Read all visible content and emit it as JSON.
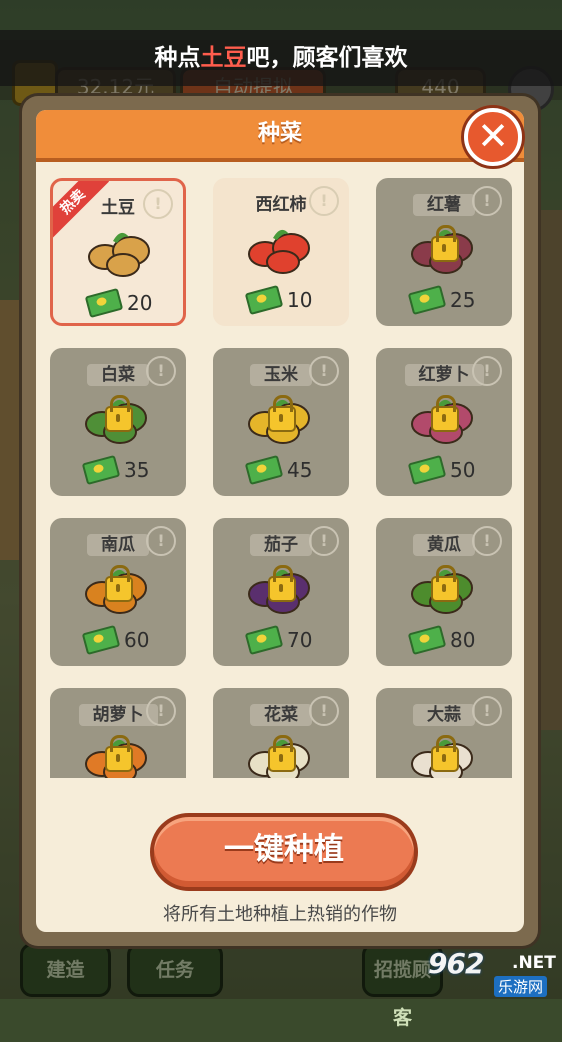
{
  "top_hint": {
    "before": "种点",
    "highlight": "土豆",
    "after": "吧，顾客们喜欢"
  },
  "hud": {
    "cash": "32.12元",
    "auto": "自动提拟",
    "count": "440"
  },
  "dialog": {
    "title": "种菜",
    "close_label": "✕",
    "ribbon": "热卖",
    "crops": [
      {
        "name": "土豆",
        "price": "20",
        "state": "selected",
        "color": "#d9a24a"
      },
      {
        "name": "西红柿",
        "price": "10",
        "state": "unlocked",
        "color": "#e0412e"
      },
      {
        "name": "红薯",
        "price": "25",
        "state": "locked",
        "color": "#8a3b4a"
      },
      {
        "name": "白菜",
        "price": "35",
        "state": "locked",
        "color": "#4f8f37"
      },
      {
        "name": "玉米",
        "price": "45",
        "state": "locked",
        "color": "#e5b52a"
      },
      {
        "name": "红萝卜",
        "price": "50",
        "state": "locked",
        "color": "#b24a6b"
      },
      {
        "name": "南瓜",
        "price": "60",
        "state": "locked",
        "color": "#d9821f"
      },
      {
        "name": "茄子",
        "price": "70",
        "state": "locked",
        "color": "#5a2f6e"
      },
      {
        "name": "黄瓜",
        "price": "80",
        "state": "locked",
        "color": "#4d8c2d"
      },
      {
        "name": "胡萝卜",
        "price": "",
        "state": "locked",
        "color": "#e07a26"
      },
      {
        "name": "花菜",
        "price": "",
        "state": "locked",
        "color": "#e8e1c6"
      },
      {
        "name": "大蒜",
        "price": "",
        "state": "locked",
        "color": "#e9e0d0"
      }
    ],
    "plant_button": "一键种植",
    "plant_desc": "将所有土地种植上热销的作物"
  },
  "bottom": {
    "build": "建造",
    "task": "任务",
    "invite": "招揽顾客"
  },
  "watermark": {
    "num": "962",
    "net": ".NET",
    "sub": "乐游网"
  }
}
